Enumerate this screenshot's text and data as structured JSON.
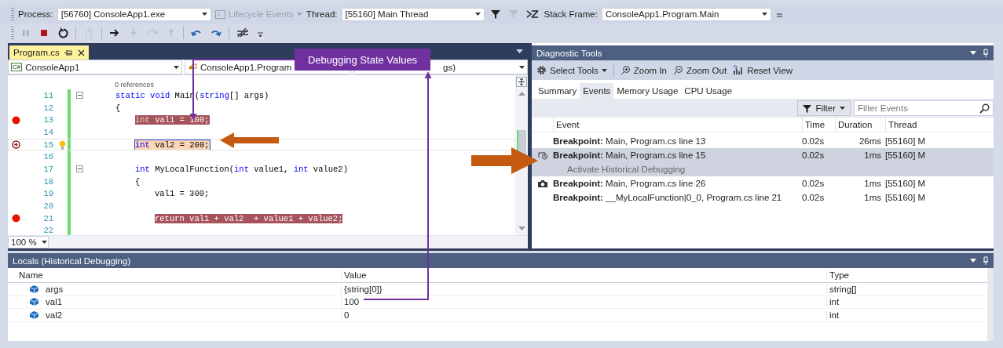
{
  "debug_toolbar": {
    "process_label": "Process:",
    "process": "[56760] ConsoleApp1.exe",
    "lifecycle_events": {
      "label": "Lifecycle Events",
      "disabled": true
    },
    "thread_label": "Thread:",
    "thread": "[55160] Main Thread",
    "stack_frame_label": "Stack Frame:",
    "stack_frame": "ConsoleApp1.Program.Main"
  },
  "editor": {
    "tab": {
      "title": "Program.cs",
      "selected": true
    },
    "nav": {
      "project_badge": "C#",
      "project": "ConsoleApp1",
      "class": "ConsoleApp1.Program",
      "member": "gs)"
    },
    "lines": [
      {
        "number": "11",
        "codelens": "0 references",
        "collapsible": true,
        "breakpoint": false,
        "current": false,
        "lightbulb": false,
        "segments": [
          {
            "text": "static void",
            "kind": "keyword"
          },
          {
            "text": " Main(",
            "kind": "plain"
          },
          {
            "text": "string",
            "kind": "keyword"
          },
          {
            "text": "[] args)",
            "kind": "plain"
          }
        ]
      },
      {
        "number": "12",
        "collapsible": false,
        "breakpoint": false,
        "current": false,
        "lightbulb": false,
        "segments": [
          {
            "text": "{",
            "kind": "plain"
          }
        ],
        "children": [
          {
            "number": "13",
            "collapsible": false,
            "breakpoint": true,
            "current": false,
            "lightbulb": false,
            "segments": [
              {
                "text": "int",
                "kind": "keyword"
              },
              {
                "text": " val1 = 100;",
                "kind": "plain"
              }
            ]
          },
          {
            "number": "14",
            "collapsible": false,
            "breakpoint": false,
            "current": false,
            "lightbulb": false
          },
          {
            "number": "15",
            "collapsible": false,
            "breakpoint": false,
            "current": true,
            "lightbulb": true,
            "segments": [
              {
                "text": "int",
                "kind": "keyword"
              },
              {
                "text": " val2 = 200;",
                "kind": "plain"
              }
            ]
          },
          {
            "number": "16",
            "collapsible": false,
            "breakpoint": false,
            "current": false,
            "lightbulb": false
          },
          {
            "number": "17",
            "collapsible": true,
            "breakpoint": false,
            "current": false,
            "lightbulb": false,
            "segments": [
              {
                "text": "int",
                "kind": "keyword"
              },
              {
                "text": " MyLocalFunction(",
                "kind": "plain"
              },
              {
                "text": "int",
                "kind": "keyword"
              },
              {
                "text": " value1, ",
                "kind": "plain"
              },
              {
                "text": "int",
                "kind": "keyword"
              },
              {
                "text": " value2)",
                "kind": "plain"
              }
            ]
          },
          {
            "number": "18",
            "collapsible": false,
            "breakpoint": false,
            "current": false,
            "lightbulb": false,
            "segments": [
              {
                "text": "{",
                "kind": "plain"
              }
            ],
            "children": [
              {
                "number": "19",
                "collapsible": false,
                "breakpoint": false,
                "current": false,
                "lightbulb": false,
                "segments": [
                  {
                    "text": "val1 = 300;",
                    "kind": "plain"
                  }
                ]
              },
              {
                "number": "20",
                "collapsible": false,
                "breakpoint": false,
                "current": false,
                "lightbulb": false
              },
              {
                "number": "21",
                "collapsible": false,
                "breakpoint": true,
                "current": false,
                "lightbulb": false,
                "segments": [
                  {
                    "text": "return val1 + val2  + value1 + value2;",
                    "kind": "plain"
                  }
                ]
              },
              {
                "number": "22",
                "collapsible": false,
                "breakpoint": false,
                "current": false,
                "lightbulb": false
              }
            ]
          }
        ]
      }
    ],
    "zoom": "100 %"
  },
  "diagnostic_tools": {
    "title": "Diagnostic Tools",
    "toolbar": [
      "Select Tools",
      "Zoom In",
      "Zoom Out",
      "Reset View"
    ],
    "tabs": [
      {
        "label": "Summary",
        "selected": false
      },
      {
        "label": "Events",
        "selected": true
      },
      {
        "label": "Memory Usage",
        "selected": false
      },
      {
        "label": "CPU Usage",
        "selected": false
      }
    ],
    "filter_button": "Filter",
    "filter_field": {
      "placeholder": "Filter Events"
    },
    "columns": [
      "Event",
      "Time",
      "Duration",
      "Thread"
    ],
    "events": [
      {
        "event": "**Breakpoint:** Main, Program.cs line 13",
        "time": "0.02s",
        "duration": "26ms",
        "thread": "[55160] M",
        "selected": false
      },
      {
        "kind": "history",
        "event": "**Breakpoint:** Main, Program.cs line 15",
        "detail": "Activate Historical Debugging",
        "time": "0.02s",
        "duration": "1ms",
        "thread": "[55160] M",
        "selected": true
      },
      {
        "kind": "snapshot",
        "event": "**Breakpoint:** Main, Program.cs line 26",
        "time": "0.02s",
        "duration": "1ms",
        "thread": "[55160] M",
        "selected": false
      },
      {
        "event": "**Breakpoint:** __MyLocalFunction|0_0, Program.cs line 21",
        "time": "0.02s",
        "duration": "1ms",
        "thread": "[55160] M",
        "selected": false
      }
    ]
  },
  "locals": {
    "title": "Locals (Historical Debugging)",
    "columns": [
      "Name",
      "Value",
      "Type"
    ],
    "rows": [
      {
        "name": "args",
        "value": "{string[0]}",
        "type": "string[]"
      },
      {
        "name": "val1",
        "value": "100",
        "type": "int"
      },
      {
        "name": "val2",
        "value": "0",
        "type": "int"
      }
    ]
  },
  "callout": "Debugging State Values"
}
